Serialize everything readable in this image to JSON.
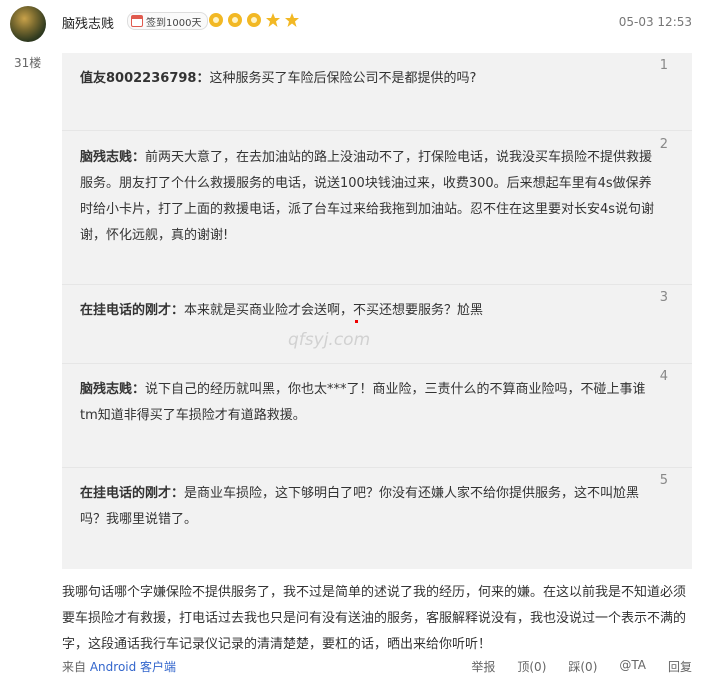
{
  "post": {
    "username": "脑残志贱",
    "badge": "签到1000天",
    "star_count": 5,
    "timestamp": "05-03 12:53",
    "floor": "31楼"
  },
  "quotes": [
    {
      "author": "值友8002236798：",
      "text": "这种服务买了车险后保险公司不是都提供的吗?",
      "num": "1"
    },
    {
      "author": "脑残志贱：",
      "text": "前两天大意了，在去加油站的路上没油动不了，打保险电话，说我没买车损险不提供救援服务。朋友打了个什么救援服务的电话，说送100块钱油过来，收费300。后来想起车里有4s做保养时给小卡片，打了上面的救援电话，派了台车过来给我拖到加油站。忍不住在这里要对长安4s说句谢谢，怀化远舰，真的谢谢!",
      "num": "2"
    },
    {
      "author": "在挂电话的刚才：",
      "text": "本来就是买商业险才会送啊，不买还想要服务？尬黑",
      "num": "3"
    },
    {
      "author": "脑残志贱：",
      "text": "说下自己的经历就叫黑，你也太***了！商业险，三责什么的不算商业险吗，不碰上事谁tm知道非得买了车损险才有道路救援。",
      "num": "4"
    },
    {
      "author": "在挂电话的刚才：",
      "text": "是商业车损险，这下够明白了吧？你没有还嫌人家不给你提供服务，这不叫尬黑吗？我哪里说错了。",
      "num": "5"
    }
  ],
  "reply": "我哪句话哪个字嫌保险不提供服务了，我不过是简单的述说了我的经历，何来的嫌。在这以前我是不知道必须要车损险才有救援，打电话过去我也只是问有没有送油的服务，客服解释说没有，我也没说过一个表示不满的字，这段通话我行车记录仪记录的清清楚楚，要杠的话，晒出来给你听听！",
  "footer": {
    "from_prefix": "来自",
    "client": "Android 客户端",
    "report": "举报",
    "up": "顶(0)",
    "down": "踩(0)",
    "at": "@TA",
    "reply": "回复"
  },
  "watermark": "qfsyj.com",
  "colors": {
    "star": "#f2b824",
    "link": "#3366cc",
    "quote_bg": "#f2f2f2"
  }
}
